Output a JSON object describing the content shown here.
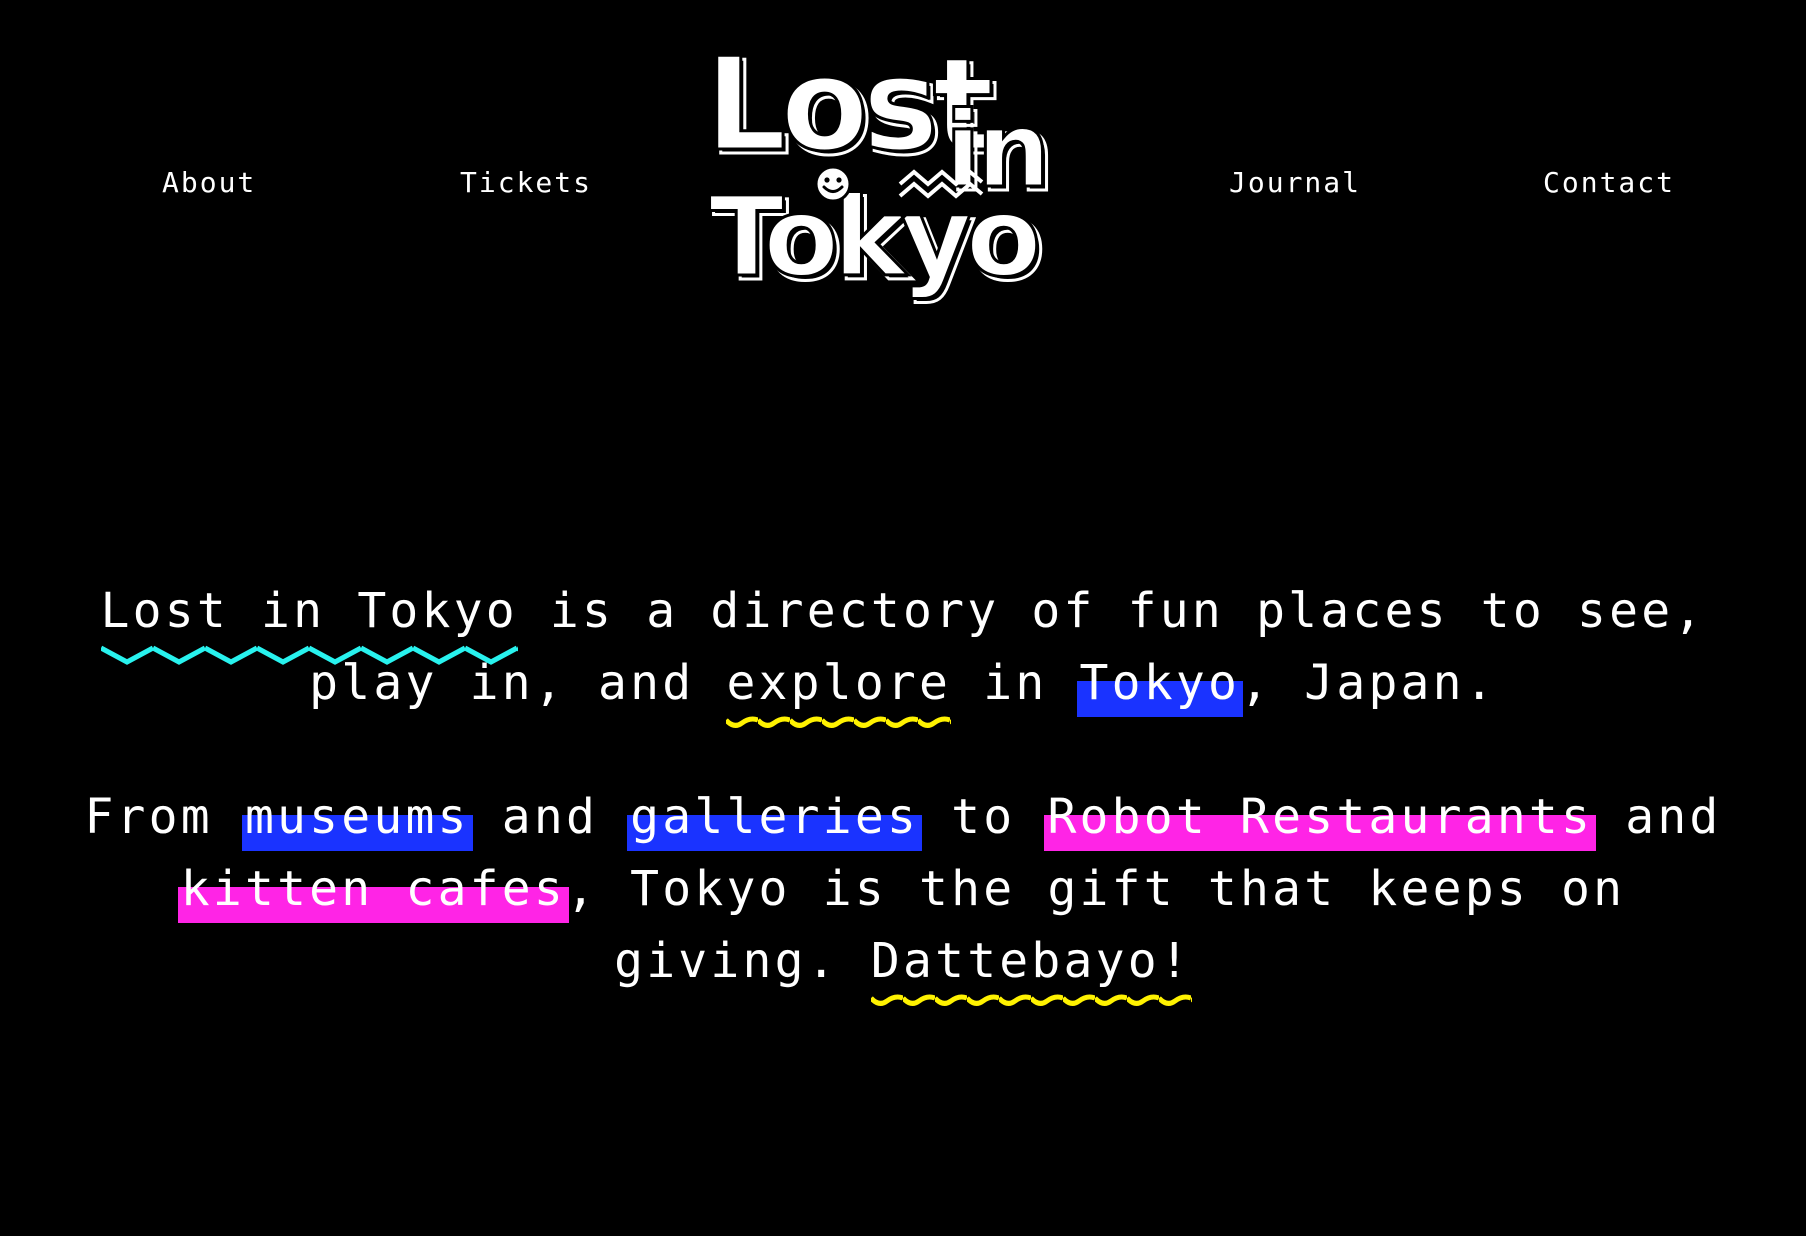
{
  "nav": {
    "items": [
      {
        "label": "About"
      },
      {
        "label": "Tickets"
      },
      {
        "label": "Journal"
      },
      {
        "label": "Contact"
      }
    ]
  },
  "logo": {
    "line1": "Lost",
    "line1b": "in",
    "line2": "Tokyo"
  },
  "intro": {
    "p1": {
      "brand": "Lost in Tokyo",
      "t1": " is a directory of fun places to see, play in, and ",
      "explore": "explore",
      "t2": " in ",
      "tokyo": "Tokyo",
      "t3": ", Japan."
    },
    "p2": {
      "t1": "From ",
      "museums": "museums",
      "t2": " and ",
      "galleries": "galleries",
      "t3": " to ",
      "robot": "Robot Restaurants",
      "t4": " and ",
      "kitten": "kitten cafes",
      "t5": ", Tokyo is the gift that keeps on giving. ",
      "dattebayo": "Dattebayo!"
    }
  },
  "colors": {
    "background": "#000000",
    "text": "#ffffff",
    "blue_highlight": "#1a33ff",
    "pink_highlight": "#ff24e6",
    "cyan_zigzag": "#28f2ee",
    "yellow_wave": "#fff200"
  }
}
